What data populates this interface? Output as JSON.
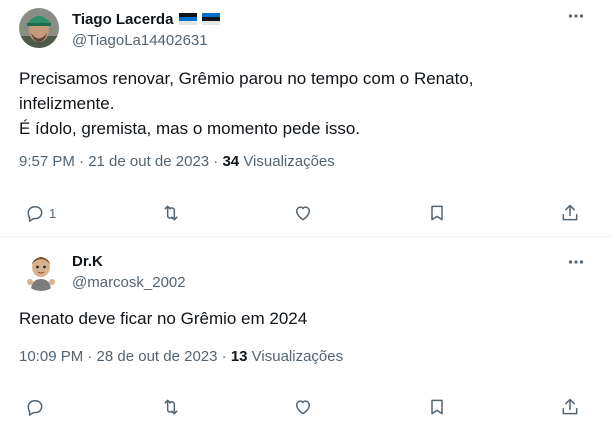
{
  "tweets": [
    {
      "display_name": "Tiago Lacerda",
      "handle": "@TiagoLa14402631",
      "lines": [
        "Precisamos renovar, Grêmio parou no tempo com o Renato,",
        "infelizmente.",
        "É ídolo, gremista, mas o momento pede isso."
      ],
      "time": "9:57 PM · 21 de out de 2023 · ",
      "views_count": "34",
      "views_label": " Visualizações",
      "reply_count": "1"
    },
    {
      "display_name": "Dr.K",
      "handle": "@marcosk_2002",
      "lines": [
        "Renato deve ficar no Grêmio em 2024"
      ],
      "time": "10:09 PM · 28 de out de 2023 · ",
      "views_count": "13",
      "views_label": " Visualizações",
      "reply_count": ""
    }
  ],
  "icons": {
    "more": "more-icon",
    "reply": "reply-icon",
    "retweet": "retweet-icon",
    "like": "like-icon",
    "bookmark": "bookmark-icon",
    "share": "share-icon"
  },
  "colors": {
    "text": "#0f1419",
    "secondary": "#536471",
    "divider": "#eff3f4"
  }
}
